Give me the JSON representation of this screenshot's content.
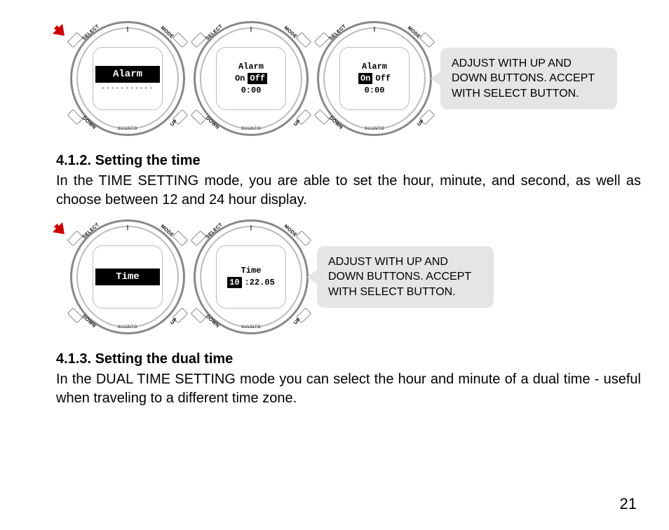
{
  "watch_labels": {
    "tl": "SELECT",
    "tr": "MODE",
    "bl": "DOWN",
    "br": "UP",
    "brand": "SUUNTO",
    "topmark": "|"
  },
  "section1": {
    "note": "ADJUST WITH UP AND DOWN BUTTONS. ACCEPT WITH SELECT BUTTON.",
    "w1": {
      "bar": "Alarm"
    },
    "w2": {
      "top": "Alarm",
      "mid_a": "On",
      "mid_b": "Off",
      "bot": "0:00"
    },
    "w3": {
      "top": "Alarm",
      "mid_a": "On",
      "mid_b": "Off",
      "bot": "0:00"
    }
  },
  "section2": {
    "heading": "4.1.2. Setting the time",
    "body": "In the TIME SETTING mode, you are able to set the hour, minute, and second, as well as choose between 12 and 24 hour display.",
    "note": "ADJUST WITH UP AND DOWN BUTTONS. ACCEPT WITH SELECT BUTTON.",
    "w1": {
      "bar": "Time"
    },
    "w2": {
      "top": "Time",
      "mid_a": "10",
      "mid_b": ":22.05"
    }
  },
  "section3": {
    "heading": "4.1.3. Setting the dual time",
    "body": "In the DUAL TIME SETTING mode you can select the hour and minute of a dual time - useful when traveling to a different time zone."
  },
  "page_number": "21"
}
